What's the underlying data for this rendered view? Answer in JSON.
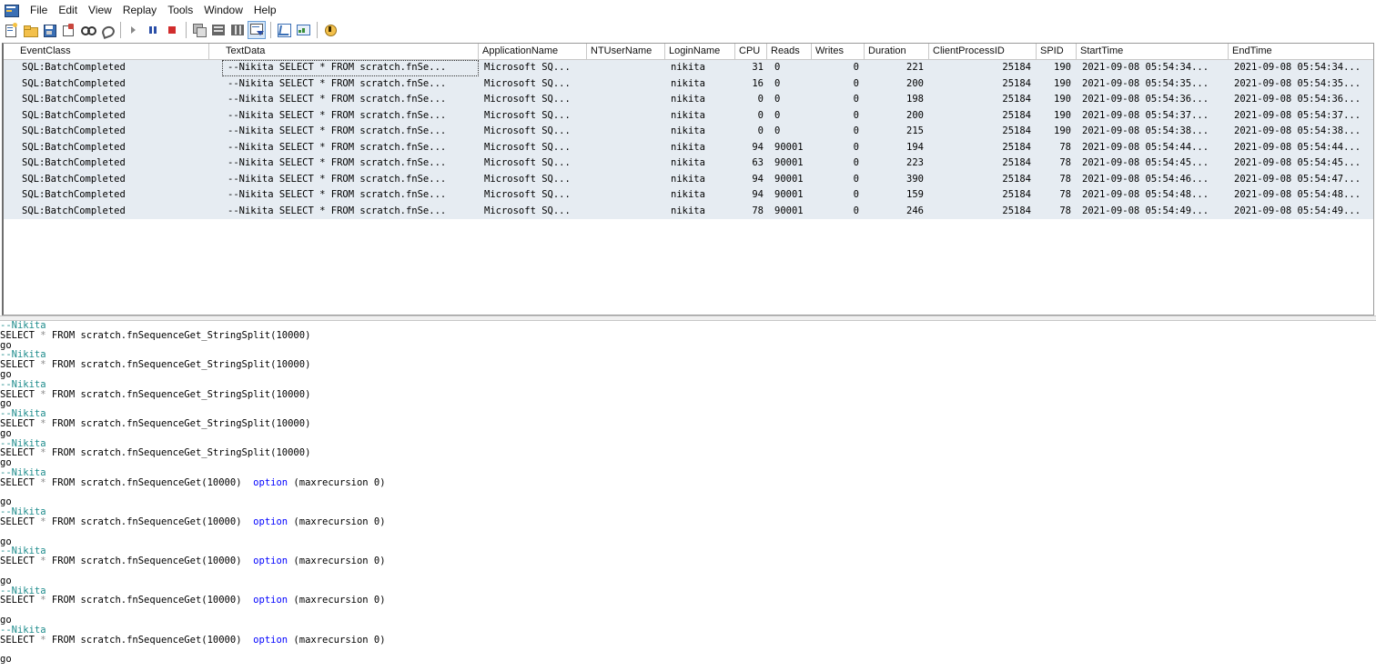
{
  "menu": [
    "File",
    "Edit",
    "View",
    "Replay",
    "Tools",
    "Window",
    "Help"
  ],
  "toolbar": {
    "icons": [
      "new-trace-icon",
      "open-icon",
      "save-icon",
      "properties-icon",
      "find-icon",
      "clear-icon",
      "run-icon",
      "pause-icon",
      "stop-icon",
      "window-icon",
      "grid-icon",
      "columns-icon",
      "autoscroll-icon",
      "performance-icon",
      "monitor-icon",
      "help-icon"
    ]
  },
  "grid": {
    "columns": [
      "EventClass",
      "TextData",
      "ApplicationName",
      "NTUserName",
      "LoginName",
      "CPU",
      "Reads",
      "Writes",
      "Duration",
      "ClientProcessID",
      "SPID",
      "StartTime",
      "EndTime"
    ],
    "rows": [
      {
        "event": "SQL:BatchCompleted",
        "text": "--Nikita  SELECT * FROM scratch.fnSe...",
        "app": "Microsoft SQ...",
        "nt": "",
        "login": "nikita",
        "cpu": "31",
        "reads": "0",
        "writes": "0",
        "duration": "221",
        "cpid": "25184",
        "spid": "190",
        "start": "2021-09-08 05:54:34...",
        "end": "2021-09-08 05:54:34..."
      },
      {
        "event": "SQL:BatchCompleted",
        "text": "--Nikita  SELECT * FROM scratch.fnSe...",
        "app": "Microsoft SQ...",
        "nt": "",
        "login": "nikita",
        "cpu": "16",
        "reads": "0",
        "writes": "0",
        "duration": "200",
        "cpid": "25184",
        "spid": "190",
        "start": "2021-09-08 05:54:35...",
        "end": "2021-09-08 05:54:35..."
      },
      {
        "event": "SQL:BatchCompleted",
        "text": "--Nikita  SELECT * FROM scratch.fnSe...",
        "app": "Microsoft SQ...",
        "nt": "",
        "login": "nikita",
        "cpu": "0",
        "reads": "0",
        "writes": "0",
        "duration": "198",
        "cpid": "25184",
        "spid": "190",
        "start": "2021-09-08 05:54:36...",
        "end": "2021-09-08 05:54:36..."
      },
      {
        "event": "SQL:BatchCompleted",
        "text": "--Nikita  SELECT * FROM scratch.fnSe...",
        "app": "Microsoft SQ...",
        "nt": "",
        "login": "nikita",
        "cpu": "0",
        "reads": "0",
        "writes": "0",
        "duration": "200",
        "cpid": "25184",
        "spid": "190",
        "start": "2021-09-08 05:54:37...",
        "end": "2021-09-08 05:54:37..."
      },
      {
        "event": "SQL:BatchCompleted",
        "text": "--Nikita  SELECT * FROM scratch.fnSe...",
        "app": "Microsoft SQ...",
        "nt": "",
        "login": "nikita",
        "cpu": "0",
        "reads": "0",
        "writes": "0",
        "duration": "215",
        "cpid": "25184",
        "spid": "190",
        "start": "2021-09-08 05:54:38...",
        "end": "2021-09-08 05:54:38..."
      },
      {
        "event": "SQL:BatchCompleted",
        "text": "--Nikita  SELECT * FROM scratch.fnSe...",
        "app": "Microsoft SQ...",
        "nt": "",
        "login": "nikita",
        "cpu": "94",
        "reads": "90001",
        "writes": "0",
        "duration": "194",
        "cpid": "25184",
        "spid": "78",
        "start": "2021-09-08 05:54:44...",
        "end": "2021-09-08 05:54:44..."
      },
      {
        "event": "SQL:BatchCompleted",
        "text": "--Nikita  SELECT * FROM scratch.fnSe...",
        "app": "Microsoft SQ...",
        "nt": "",
        "login": "nikita",
        "cpu": "63",
        "reads": "90001",
        "writes": "0",
        "duration": "223",
        "cpid": "25184",
        "spid": "78",
        "start": "2021-09-08 05:54:45...",
        "end": "2021-09-08 05:54:45..."
      },
      {
        "event": "SQL:BatchCompleted",
        "text": "--Nikita  SELECT * FROM scratch.fnSe...",
        "app": "Microsoft SQ...",
        "nt": "",
        "login": "nikita",
        "cpu": "94",
        "reads": "90001",
        "writes": "0",
        "duration": "390",
        "cpid": "25184",
        "spid": "78",
        "start": "2021-09-08 05:54:46...",
        "end": "2021-09-08 05:54:47..."
      },
      {
        "event": "SQL:BatchCompleted",
        "text": "--Nikita  SELECT * FROM scratch.fnSe...",
        "app": "Microsoft SQ...",
        "nt": "",
        "login": "nikita",
        "cpu": "94",
        "reads": "90001",
        "writes": "0",
        "duration": "159",
        "cpid": "25184",
        "spid": "78",
        "start": "2021-09-08 05:54:48...",
        "end": "2021-09-08 05:54:48..."
      },
      {
        "event": "SQL:BatchCompleted",
        "text": "--Nikita  SELECT * FROM scratch.fnSe...",
        "app": "Microsoft SQ...",
        "nt": "",
        "login": "nikita",
        "cpu": "78",
        "reads": "90001",
        "writes": "0",
        "duration": "246",
        "cpid": "25184",
        "spid": "78",
        "start": "2021-09-08 05:54:49...",
        "end": "2021-09-08 05:54:49..."
      }
    ]
  },
  "textpane": {
    "lines": [
      [
        {
          "t": "--Nikita",
          "c": "cmt"
        }
      ],
      [
        {
          "t": "SELECT ",
          "c": "txt"
        },
        {
          "t": "*",
          "c": "op"
        },
        {
          "t": " FROM scratch.fnSequenceGet_StringSplit(10000)",
          "c": "txt"
        }
      ],
      [
        {
          "t": "go",
          "c": "txt"
        }
      ],
      [
        {
          "t": "--Nikita",
          "c": "cmt"
        }
      ],
      [
        {
          "t": "SELECT ",
          "c": "txt"
        },
        {
          "t": "*",
          "c": "op"
        },
        {
          "t": " FROM scratch.fnSequenceGet_StringSplit(10000)",
          "c": "txt"
        }
      ],
      [
        {
          "t": "go",
          "c": "txt"
        }
      ],
      [
        {
          "t": "--Nikita",
          "c": "cmt"
        }
      ],
      [
        {
          "t": "SELECT ",
          "c": "txt"
        },
        {
          "t": "*",
          "c": "op"
        },
        {
          "t": " FROM scratch.fnSequenceGet_StringSplit(10000)",
          "c": "txt"
        }
      ],
      [
        {
          "t": "go",
          "c": "txt"
        }
      ],
      [
        {
          "t": "--Nikita",
          "c": "cmt"
        }
      ],
      [
        {
          "t": "SELECT ",
          "c": "txt"
        },
        {
          "t": "*",
          "c": "op"
        },
        {
          "t": " FROM scratch.fnSequenceGet_StringSplit(10000)",
          "c": "txt"
        }
      ],
      [
        {
          "t": "go",
          "c": "txt"
        }
      ],
      [
        {
          "t": "--Nikita",
          "c": "cmt"
        }
      ],
      [
        {
          "t": "SELECT ",
          "c": "txt"
        },
        {
          "t": "*",
          "c": "op"
        },
        {
          "t": " FROM scratch.fnSequenceGet_StringSplit(10000)",
          "c": "txt"
        }
      ],
      [
        {
          "t": "go",
          "c": "txt"
        }
      ],
      [
        {
          "t": "--Nikita",
          "c": "cmt"
        }
      ],
      [
        {
          "t": "SELECT ",
          "c": "txt"
        },
        {
          "t": "*",
          "c": "op"
        },
        {
          "t": " FROM scratch.fnSequenceGet(10000)  ",
          "c": "txt"
        },
        {
          "t": "option",
          "c": "kw"
        },
        {
          "t": " (maxrecursion 0)",
          "c": "txt"
        }
      ],
      [],
      [
        {
          "t": "go",
          "c": "txt"
        }
      ],
      [
        {
          "t": "--Nikita",
          "c": "cmt"
        }
      ],
      [
        {
          "t": "SELECT ",
          "c": "txt"
        },
        {
          "t": "*",
          "c": "op"
        },
        {
          "t": " FROM scratch.fnSequenceGet(10000)  ",
          "c": "txt"
        },
        {
          "t": "option",
          "c": "kw"
        },
        {
          "t": " (maxrecursion 0)",
          "c": "txt"
        }
      ],
      [],
      [
        {
          "t": "go",
          "c": "txt"
        }
      ],
      [
        {
          "t": "--Nikita",
          "c": "cmt"
        }
      ],
      [
        {
          "t": "SELECT ",
          "c": "txt"
        },
        {
          "t": "*",
          "c": "op"
        },
        {
          "t": " FROM scratch.fnSequenceGet(10000)  ",
          "c": "txt"
        },
        {
          "t": "option",
          "c": "kw"
        },
        {
          "t": " (maxrecursion 0)",
          "c": "txt"
        }
      ],
      [],
      [
        {
          "t": "go",
          "c": "txt"
        }
      ],
      [
        {
          "t": "--Nikita",
          "c": "cmt"
        }
      ],
      [
        {
          "t": "SELECT ",
          "c": "txt"
        },
        {
          "t": "*",
          "c": "op"
        },
        {
          "t": " FROM scratch.fnSequenceGet(10000)  ",
          "c": "txt"
        },
        {
          "t": "option",
          "c": "kw"
        },
        {
          "t": " (maxrecursion 0)",
          "c": "txt"
        }
      ],
      [],
      [
        {
          "t": "go",
          "c": "txt"
        }
      ],
      [
        {
          "t": "--Nikita",
          "c": "cmt"
        }
      ],
      [
        {
          "t": "SELECT ",
          "c": "txt"
        },
        {
          "t": "*",
          "c": "op"
        },
        {
          "t": " FROM scratch.fnSequenceGet(10000)  ",
          "c": "txt"
        },
        {
          "t": "option",
          "c": "kw"
        },
        {
          "t": " (maxrecursion 0)",
          "c": "txt"
        }
      ],
      [],
      [
        {
          "t": "go",
          "c": "txt"
        }
      ]
    ]
  }
}
